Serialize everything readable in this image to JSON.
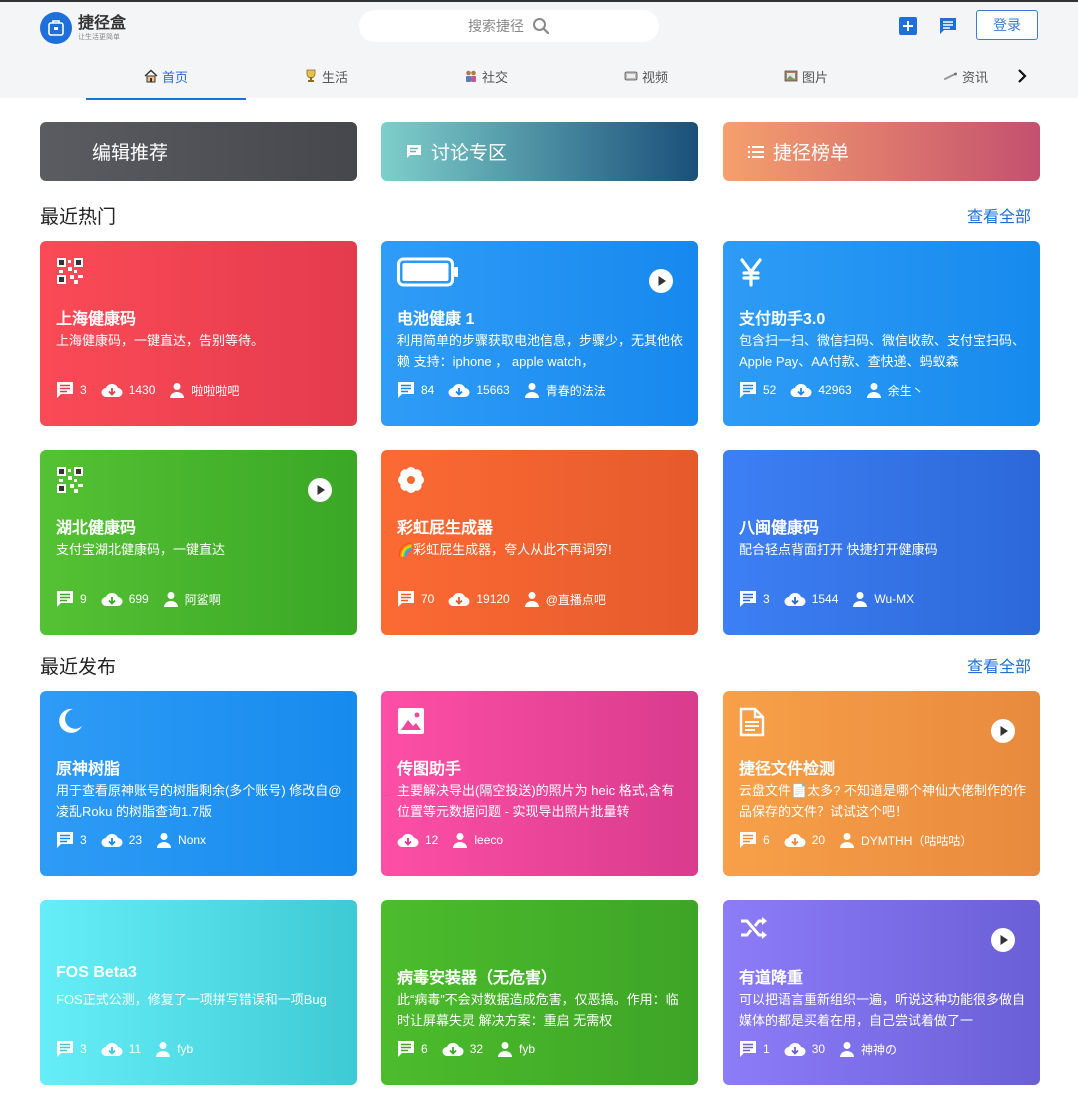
{
  "header": {
    "logo_title": "捷径盒",
    "logo_subtitle": "让生活更简单",
    "search_placeholder": "搜索捷径",
    "login_label": "登录"
  },
  "nav": [
    {
      "label": "首页",
      "icon": "home-icon"
    },
    {
      "label": "生活",
      "icon": "trophy-icon"
    },
    {
      "label": "社交",
      "icon": "people-icon"
    },
    {
      "label": "视频",
      "icon": "tv-icon"
    },
    {
      "label": "图片",
      "icon": "picture-icon"
    },
    {
      "label": "资讯",
      "icon": "news-icon"
    }
  ],
  "banners": [
    {
      "label": "编辑推荐",
      "colors": [
        "#5b5c61",
        "#46474c"
      ]
    },
    {
      "label": "讨论专区",
      "colors": [
        "#7ecfcb",
        "#1a4f7a"
      ]
    },
    {
      "label": "捷径榜单",
      "colors": [
        "#f5a06d",
        "#c4506f"
      ]
    }
  ],
  "sections": {
    "hot_title": "最近热门",
    "recent_title": "最近发布",
    "see_all": "查看全部"
  },
  "hot_cards": [
    {
      "title": "上海健康码",
      "desc": "上海健康码，一键直达，告别等待。",
      "comments": "3",
      "downloads": "1430",
      "author": "啦啦啦吧",
      "icon": "qrcode-icon",
      "play": false,
      "colors": [
        "#fb4a57",
        "#e43b4d"
      ]
    },
    {
      "title": "电池健康 1",
      "desc": "利用简单的步骤获取电池信息，步骤少，无其他依赖 支持：iphone ， apple watch，",
      "comments": "84",
      "downloads": "15663",
      "author": "青春的法法",
      "icon": "battery-icon",
      "play": true,
      "colors": [
        "#2f9cf7",
        "#1788ee"
      ]
    },
    {
      "title": "支付助手3.0",
      "desc": "包含扫一扫、微信扫码、微信收款、支付宝扫码、Apple Pay、AA付款、查快递、蚂蚁森",
      "comments": "52",
      "downloads": "42963",
      "author": "余生丶",
      "icon": "yen-icon",
      "play": false,
      "colors": [
        "#2e9cf6",
        "#178aee"
      ]
    },
    {
      "title": "湖北健康码",
      "desc": "支付宝湖北健康码，一键直达",
      "comments": "9",
      "downloads": "699",
      "author": "阿鲨啊",
      "icon": "qrcode-icon",
      "play": true,
      "colors": [
        "#55c134",
        "#3aa726"
      ]
    },
    {
      "title": "彩虹屁生成器",
      "desc": "🌈彩虹屁生成器，夸人从此不再词穷!",
      "comments": "70",
      "downloads": "19120",
      "author": "@直播点吧",
      "icon": "flower-icon",
      "play": false,
      "colors": [
        "#fc6a34",
        "#e55a2c"
      ]
    },
    {
      "title": "八闽健康码",
      "desc": "配合轻点背面打开 快捷打开健康码",
      "comments": "3",
      "downloads": "1544",
      "author": "Wu-MX",
      "icon": "none",
      "play": false,
      "colors": [
        "#3d7ff5",
        "#2c68d8"
      ]
    }
  ],
  "recent_cards": [
    {
      "title": "原神树脂",
      "desc": "用于查看原神账号的树脂剩余(多个账号) 修改自@凌乱Roku 的树脂查询1.7版",
      "comments": "3",
      "downloads": "23",
      "author": "Nonx",
      "icon": "moon-icon",
      "play": false,
      "colors": [
        "#2e9cf6",
        "#178aee"
      ]
    },
    {
      "title": "传图助手",
      "desc": "主要解决导出(隔空投送)的照片为 heic 格式,含有位置等元数据问题 - 实现导出照片批量转",
      "comments": "",
      "downloads": "12",
      "author": "leeco",
      "icon": "image-icon",
      "play": false,
      "colors": [
        "#fd4fa6",
        "#d93b8d"
      ]
    },
    {
      "title": "捷径文件检测",
      "desc": "云盘文件📄太多? 不知道是哪个神仙大佬制作的作品保存的文件？试试这个吧！",
      "comments": "6",
      "downloads": "20",
      "author": "DYMTHH（咕咕咕）",
      "icon": "file-icon",
      "play": true,
      "colors": [
        "#f7a049",
        "#e88a3d"
      ]
    },
    {
      "title": "FOS Beta3",
      "desc": "FOS正式公测，修复了一项拼写错误和一项Bug",
      "comments": "3",
      "downloads": "11",
      "author": "fyb",
      "icon": "none",
      "play": false,
      "colors": [
        "#66eef8",
        "#3ecad4"
      ]
    },
    {
      "title": "病毒安装器（无危害）",
      "desc": "此“病毒”不会对数据造成危害，仅恶搞。作用：临时让屏幕失灵 解决方案：重启 无需权",
      "comments": "6",
      "downloads": "32",
      "author": "fyb",
      "icon": "none",
      "play": false,
      "colors": [
        "#4cbc2c",
        "#3ea427"
      ]
    },
    {
      "title": "有道降重",
      "desc": "可以把语言重新组织一遍，听说这种功能很多做自媒体的都是买着在用，自己尝试着做了一",
      "comments": "1",
      "downloads": "30",
      "author": "神神の",
      "icon": "shuffle-icon",
      "play": true,
      "colors": [
        "#8d7cf8",
        "#6a5fd6"
      ]
    }
  ]
}
